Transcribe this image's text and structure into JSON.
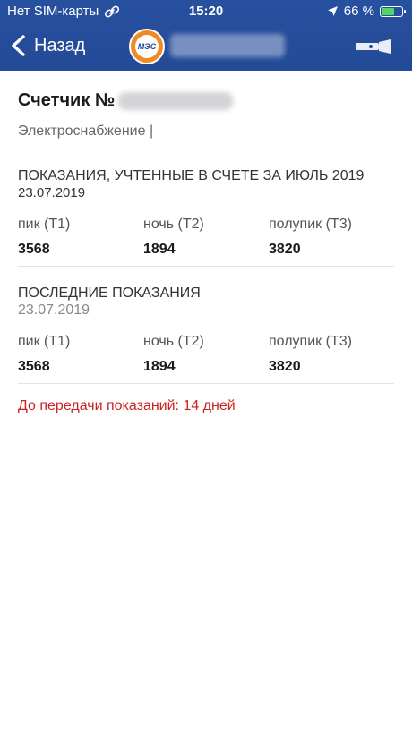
{
  "status_bar": {
    "carrier": "Нет SIM-карты",
    "time": "15:20",
    "battery": "66 %",
    "battery_level": 0.66
  },
  "nav": {
    "back_label": "Назад",
    "logo_text": "МЭС"
  },
  "meter": {
    "title": "Счетчик №",
    "service": "Электроснабжение |"
  },
  "billed_readings": {
    "title": "ПОКАЗАНИЯ,  УЧТЕННЫЕ В СЧЕТЕ ЗА ИЮЛЬ 2019",
    "date": "23.07.2019",
    "tariffs": [
      {
        "label": "пик (Т1)",
        "value": "3568"
      },
      {
        "label": "ночь (Т2)",
        "value": "1894"
      },
      {
        "label": "полупик (Т3)",
        "value": "3820"
      }
    ]
  },
  "last_readings": {
    "title": "ПОСЛЕДНИЕ ПОКАЗАНИЯ",
    "date": "23.07.2019",
    "tariffs": [
      {
        "label": "пик (Т1)",
        "value": "3568"
      },
      {
        "label": "ночь (Т2)",
        "value": "1894"
      },
      {
        "label": "полупик (Т3)",
        "value": "3820"
      }
    ]
  },
  "deadline_text": "До передачи показаний: 14 дней",
  "colors": {
    "header_bg": "#234a96",
    "logo_orange": "#f08a24",
    "battery_green": "#4cd964",
    "deadline_red": "#cc2222"
  }
}
